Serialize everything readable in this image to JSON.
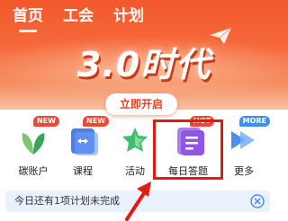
{
  "tabs": [
    {
      "label": "首页"
    },
    {
      "label": "工会"
    },
    {
      "label": "计划"
    }
  ],
  "banner": {
    "title": "3.0时代",
    "cta_label": "立即开启"
  },
  "features": [
    {
      "label": "碳账户",
      "icon": "carbon-leaf-icon",
      "badge": "NEW"
    },
    {
      "label": "课程",
      "icon": "course-book-icon",
      "badge": "NEW"
    },
    {
      "label": "活动",
      "icon": "activity-star-icon",
      "badge": ""
    },
    {
      "label": "每日答题",
      "icon": "daily-quiz-icon",
      "badge": "HOT"
    },
    {
      "label": "更多",
      "icon": "more-arrow-icon",
      "badge": "MORE"
    }
  ],
  "notice": {
    "text": "今日还有1项计划未完成",
    "close_icon": "close-icon"
  },
  "colors": {
    "header": "#f2582c",
    "highlight": "#e01b12",
    "notice_bg": "#e9f1fd",
    "badge_red": "#f04832",
    "badge_blue": "#3d8ef5"
  }
}
